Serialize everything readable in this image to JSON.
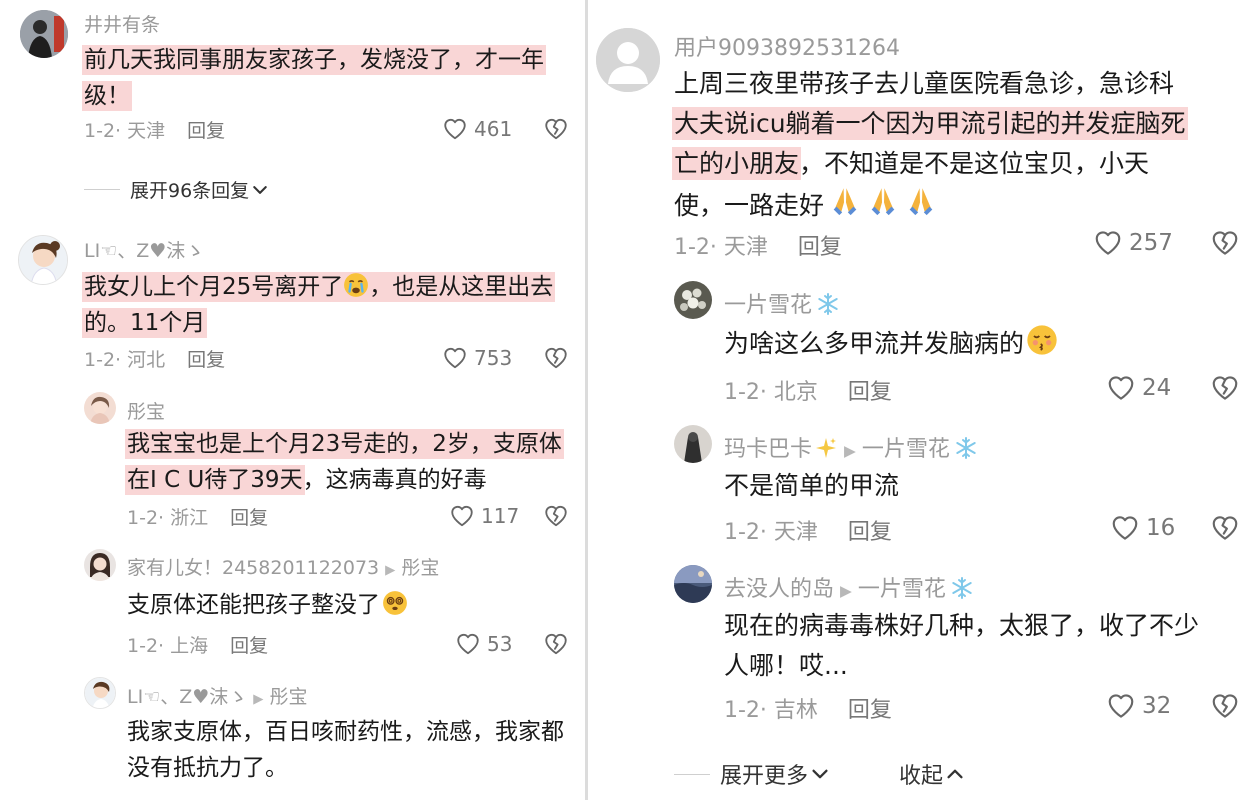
{
  "left": {
    "c1": {
      "username": "井井有条",
      "text_lines": [
        "前几天我同事朋友家孩子，发烧没了，才一年",
        "级！"
      ],
      "meta": "1-2· 天津",
      "reply": "回复",
      "likes": "461",
      "expand": "展开96条回复"
    },
    "c2": {
      "username": "LI☜、Z♥沫ゝ",
      "text_part1": "我女儿上个月25号离开了",
      "text_part2": "，也是从这里出去",
      "text_line2": "的。11个月",
      "meta": "1-2· 河北",
      "reply": "回复",
      "likes": "753"
    },
    "c3": {
      "username": "彤宝",
      "text_line1": "我宝宝也是上个月23号走的，2岁，支原体",
      "text_line2_hl": "在I C U待了39天",
      "text_line2_rest": "，这病毒真的好毒",
      "meta": "1-2· 浙江",
      "reply": "回复",
      "likes": "117"
    },
    "c4": {
      "username": "家有儿女！2458201122073",
      "reply_to": "彤宝",
      "text": "支原体还能把孩子整没了",
      "meta": "1-2· 上海",
      "reply": "回复",
      "likes": "53"
    },
    "c5": {
      "username": "LI☜、Z♥沫ゝ",
      "reply_to": "彤宝",
      "text_lines": [
        "我家支原体，百日咳耐药性，流感，我家都",
        "没有抵抗力了。"
      ]
    }
  },
  "right": {
    "c1": {
      "username": "用户9093892531264",
      "line1": "上周三夜里带孩子去儿童医院看急诊，急诊科",
      "line2_hl": "大夫说icu躺着一个因为甲流引起的并发症脑死",
      "line3_hl": "亡的小朋友",
      "line3_rest": "，不知道是不是这位宝贝，小天",
      "line4": "使，一路走好",
      "meta": "1-2· 天津",
      "reply": "回复",
      "likes": "257"
    },
    "c2": {
      "username": "一片雪花",
      "text": "为啥这么多甲流并发脑病的",
      "meta": "1-2· 北京",
      "reply": "回复",
      "likes": "24"
    },
    "c3": {
      "username": "玛卡巴卡",
      "reply_to": "一片雪花",
      "text": "不是简单的甲流",
      "meta": "1-2· 天津",
      "reply": "回复",
      "likes": "16"
    },
    "c4": {
      "username": "去没人的岛",
      "reply_to": "一片雪花",
      "text_lines": [
        "现在的病毒毒株好几种，太狠了，收了不少",
        "人哪！哎..."
      ],
      "meta": "1-2· 吉林",
      "reply": "回复",
      "likes": "32"
    },
    "footer": {
      "expand_more": "展开更多",
      "collapse": "收起"
    }
  },
  "icons": {
    "heart": "heart-outline-icon",
    "dislike": "broken-heart-icon",
    "chevron_down": "chevron-down-icon",
    "chevron_up": "chevron-up-icon"
  },
  "colors": {
    "highlight": "#f9d6d6",
    "meta_text": "#9a9a9a",
    "body_text": "#1a1a1a"
  }
}
